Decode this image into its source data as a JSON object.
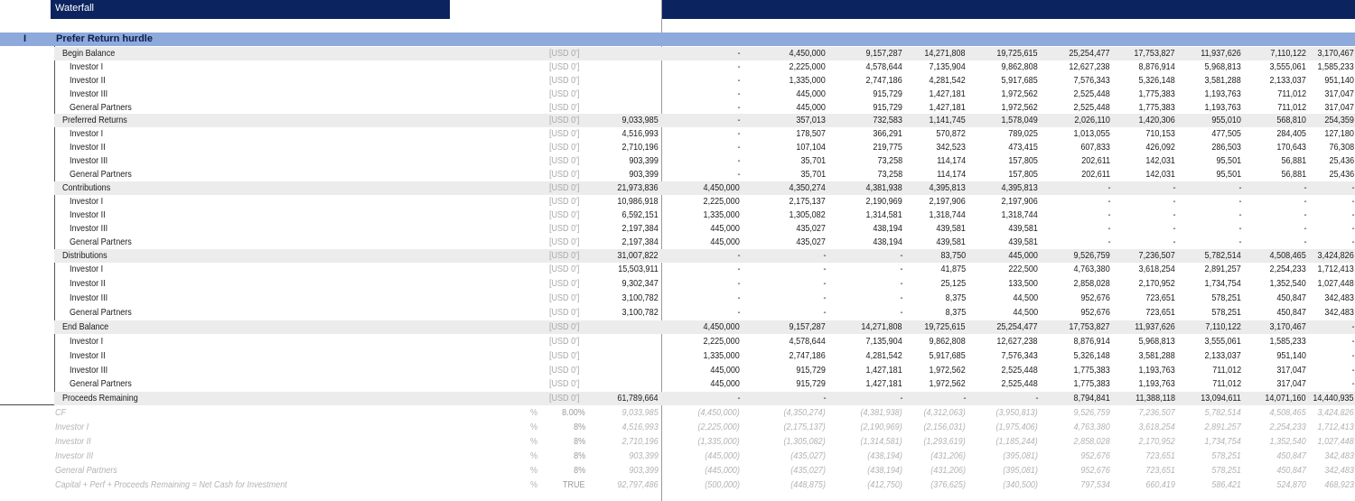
{
  "header": {
    "title": "Waterfall"
  },
  "section": {
    "number": "I",
    "title": "Prefer Return hurdle"
  },
  "unit_label": "[USD 0']",
  "rows": [
    {
      "label": "Begin Balance",
      "level": 0,
      "shade": true,
      "values": [
        "",
        "-",
        "4,450,000",
        "9,157,287",
        "14,271,808",
        "19,725,615",
        "25,254,477",
        "17,753,827",
        "11,937,626",
        "7,110,122",
        "3,170,467"
      ]
    },
    {
      "label": "Investor I",
      "level": 1,
      "values": [
        "",
        "-",
        "2,225,000",
        "4,578,644",
        "7,135,904",
        "9,862,808",
        "12,627,238",
        "8,876,914",
        "5,968,813",
        "3,555,061",
        "1,585,233"
      ]
    },
    {
      "label": "Investor II",
      "level": 1,
      "values": [
        "",
        "-",
        "1,335,000",
        "2,747,186",
        "4,281,542",
        "5,917,685",
        "7,576,343",
        "5,326,148",
        "3,581,288",
        "2,133,037",
        "951,140"
      ]
    },
    {
      "label": "Investor III",
      "level": 1,
      "values": [
        "",
        "-",
        "445,000",
        "915,729",
        "1,427,181",
        "1,972,562",
        "2,525,448",
        "1,775,383",
        "1,193,763",
        "711,012",
        "317,047"
      ]
    },
    {
      "label": "General Partners",
      "level": 1,
      "values": [
        "",
        "-",
        "445,000",
        "915,729",
        "1,427,181",
        "1,972,562",
        "2,525,448",
        "1,775,383",
        "1,193,763",
        "711,012",
        "317,047"
      ]
    },
    {
      "label": "Preferred Returns",
      "level": 0,
      "shade": true,
      "values": [
        "9,033,985",
        "-",
        "357,013",
        "732,583",
        "1,141,745",
        "1,578,049",
        "2,026,110",
        "1,420,306",
        "955,010",
        "568,810",
        "254,359"
      ]
    },
    {
      "label": "Investor I",
      "level": 1,
      "values": [
        "4,516,993",
        "-",
        "178,507",
        "366,291",
        "570,872",
        "789,025",
        "1,013,055",
        "710,153",
        "477,505",
        "284,405",
        "127,180"
      ]
    },
    {
      "label": "Investor II",
      "level": 1,
      "values": [
        "2,710,196",
        "-",
        "107,104",
        "219,775",
        "342,523",
        "473,415",
        "607,833",
        "426,092",
        "286,503",
        "170,643",
        "76,308"
      ]
    },
    {
      "label": "Investor III",
      "level": 1,
      "values": [
        "903,399",
        "-",
        "35,701",
        "73,258",
        "114,174",
        "157,805",
        "202,611",
        "142,031",
        "95,501",
        "56,881",
        "25,436"
      ]
    },
    {
      "label": "General Partners",
      "level": 1,
      "values": [
        "903,399",
        "-",
        "35,701",
        "73,258",
        "114,174",
        "157,805",
        "202,611",
        "142,031",
        "95,501",
        "56,881",
        "25,436"
      ]
    },
    {
      "label": "Contributions",
      "level": 0,
      "shade": true,
      "values": [
        "21,973,836",
        "4,450,000",
        "4,350,274",
        "4,381,938",
        "4,395,813",
        "4,395,813",
        "-",
        "-",
        "-",
        "-",
        "-"
      ]
    },
    {
      "label": "Investor I",
      "level": 1,
      "values": [
        "10,986,918",
        "2,225,000",
        "2,175,137",
        "2,190,969",
        "2,197,906",
        "2,197,906",
        "-",
        "-",
        "-",
        "-",
        "-"
      ]
    },
    {
      "label": "Investor II",
      "level": 1,
      "values": [
        "6,592,151",
        "1,335,000",
        "1,305,082",
        "1,314,581",
        "1,318,744",
        "1,318,744",
        "-",
        "-",
        "-",
        "-",
        "-"
      ]
    },
    {
      "label": "Investor III",
      "level": 1,
      "values": [
        "2,197,384",
        "445,000",
        "435,027",
        "438,194",
        "439,581",
        "439,581",
        "-",
        "-",
        "-",
        "-",
        "-"
      ]
    },
    {
      "label": "General Partners",
      "level": 1,
      "values": [
        "2,197,384",
        "445,000",
        "435,027",
        "438,194",
        "439,581",
        "439,581",
        "-",
        "-",
        "-",
        "-",
        "-"
      ]
    },
    {
      "label": "Distributions",
      "level": 0,
      "shade": true,
      "values": [
        "31,007,822",
        "-",
        "-",
        "-",
        "83,750",
        "445,000",
        "9,526,759",
        "7,236,507",
        "5,782,514",
        "4,508,465",
        "3,424,826"
      ]
    },
    {
      "label": "Investor I",
      "level": 1,
      "values": [
        "15,503,911",
        "-",
        "-",
        "-",
        "41,875",
        "222,500",
        "4,763,380",
        "3,618,254",
        "2,891,257",
        "2,254,233",
        "1,712,413"
      ]
    },
    {
      "label": "Investor II",
      "level": 1,
      "values": [
        "9,302,347",
        "-",
        "-",
        "-",
        "25,125",
        "133,500",
        "2,858,028",
        "2,170,952",
        "1,734,754",
        "1,352,540",
        "1,027,448"
      ]
    },
    {
      "label": "Investor III",
      "level": 1,
      "values": [
        "3,100,782",
        "-",
        "-",
        "-",
        "8,375",
        "44,500",
        "952,676",
        "723,651",
        "578,251",
        "450,847",
        "342,483"
      ]
    },
    {
      "label": "General Partners",
      "level": 1,
      "values": [
        "3,100,782",
        "-",
        "-",
        "-",
        "8,375",
        "44,500",
        "952,676",
        "723,651",
        "578,251",
        "450,847",
        "342,483"
      ]
    },
    {
      "label": "End Balance",
      "level": 0,
      "shade": true,
      "values": [
        "",
        "4,450,000",
        "9,157,287",
        "14,271,808",
        "19,725,615",
        "25,254,477",
        "17,753,827",
        "11,937,626",
        "7,110,122",
        "3,170,467",
        "-"
      ]
    },
    {
      "label": "Investor I",
      "level": 1,
      "values": [
        "",
        "2,225,000",
        "4,578,644",
        "7,135,904",
        "9,862,808",
        "12,627,238",
        "8,876,914",
        "5,968,813",
        "3,555,061",
        "1,585,233",
        "-"
      ]
    },
    {
      "label": "Investor II",
      "level": 1,
      "values": [
        "",
        "1,335,000",
        "2,747,186",
        "4,281,542",
        "5,917,685",
        "7,576,343",
        "5,326,148",
        "3,581,288",
        "2,133,037",
        "951,140",
        "-"
      ]
    },
    {
      "label": "Investor III",
      "level": 1,
      "values": [
        "",
        "445,000",
        "915,729",
        "1,427,181",
        "1,972,562",
        "2,525,448",
        "1,775,383",
        "1,193,763",
        "711,012",
        "317,047",
        "-"
      ]
    },
    {
      "label": "General Partners",
      "level": 1,
      "values": [
        "",
        "445,000",
        "915,729",
        "1,427,181",
        "1,972,562",
        "2,525,448",
        "1,775,383",
        "1,193,763",
        "711,012",
        "317,047",
        "-"
      ]
    },
    {
      "label": "Proceeds Remaining",
      "level": 0,
      "shade": true,
      "summary": true,
      "values": [
        "61,789,664",
        "-",
        "-",
        "-",
        "-",
        "-",
        "8,794,841",
        "11,388,118",
        "13,094,611",
        "14,071,160",
        "14,440,935"
      ]
    }
  ],
  "notes": [
    {
      "label": "CF",
      "pct": "%",
      "rate": "8.00%",
      "values": [
        "9,033,985",
        "(4,450,000)",
        "(4,350,274)",
        "(4,381,938)",
        "(4,312,063)",
        "(3,950,813)",
        "9,526,759",
        "7,236,507",
        "5,782,514",
        "4,508,465",
        "3,424,826"
      ]
    },
    {
      "label": "Investor I",
      "pct": "%",
      "rate": "8%",
      "values": [
        "4,516,993",
        "(2,225,000)",
        "(2,175,137)",
        "(2,190,969)",
        "(2,156,031)",
        "(1,975,406)",
        "4,763,380",
        "3,618,254",
        "2,891,257",
        "2,254,233",
        "1,712,413"
      ]
    },
    {
      "label": "Investor II",
      "pct": "%",
      "rate": "8%",
      "values": [
        "2,710,196",
        "(1,335,000)",
        "(1,305,082)",
        "(1,314,581)",
        "(1,293,619)",
        "(1,185,244)",
        "2,858,028",
        "2,170,952",
        "1,734,754",
        "1,352,540",
        "1,027,448"
      ]
    },
    {
      "label": "Investor III",
      "pct": "%",
      "rate": "8%",
      "values": [
        "903,399",
        "(445,000)",
        "(435,027)",
        "(438,194)",
        "(431,206)",
        "(395,081)",
        "952,676",
        "723,651",
        "578,251",
        "450,847",
        "342,483"
      ]
    },
    {
      "label": "General Partners",
      "pct": "%",
      "rate": "8%",
      "values": [
        "903,399",
        "(445,000)",
        "(435,027)",
        "(438,194)",
        "(431,206)",
        "(395,081)",
        "952,676",
        "723,651",
        "578,251",
        "450,847",
        "342,483"
      ]
    },
    {
      "label": "Capital + Perf + Proceeds Remaining = Net Cash for Investment",
      "pct": "%",
      "rate": "TRUE",
      "values": [
        "92,797,486",
        "(500,000)",
        "(448,875)",
        "(412,750)",
        "(376,625)",
        "(340,500)",
        "797,534",
        "660,419",
        "586,421",
        "524,870",
        "468,923"
      ]
    }
  ]
}
